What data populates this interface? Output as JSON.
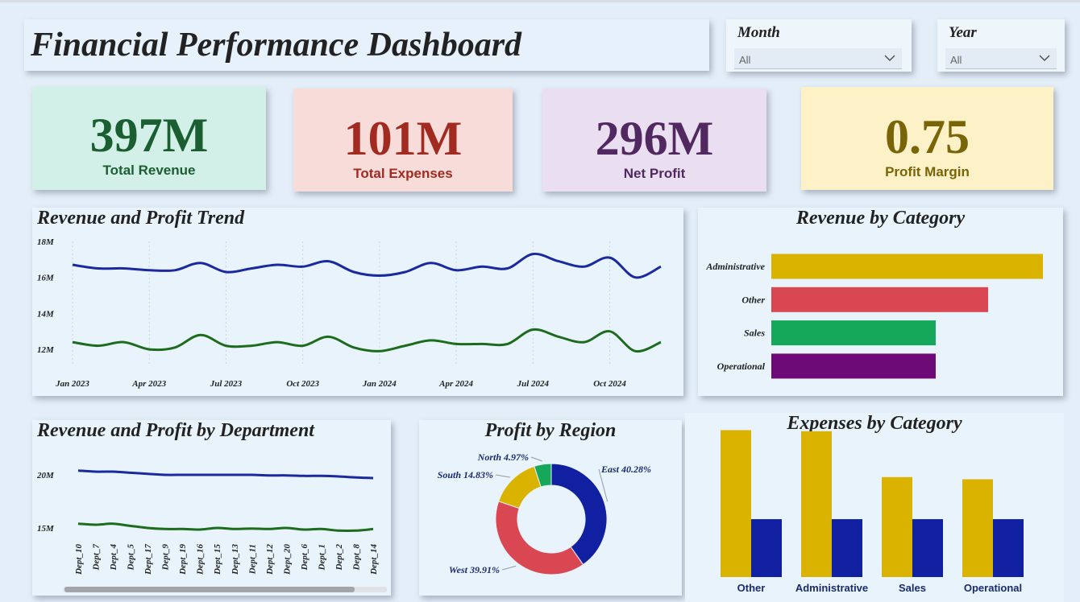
{
  "header": {
    "title": "Financial Performance Dashboard"
  },
  "filters": {
    "month": {
      "label": "Month",
      "value": "All"
    },
    "year": {
      "label": "Year",
      "value": "All"
    }
  },
  "kpis": [
    {
      "value": "397M",
      "label": "Total Revenue",
      "color": "#1a5e32",
      "bg": "#d3f0e8"
    },
    {
      "value": "101M",
      "label": "Total Expenses",
      "color": "#a12b21",
      "bg": "#f8dcd9"
    },
    {
      "value": "296M",
      "label": "Net Profit",
      "color": "#512960",
      "bg": "#eadff0"
    },
    {
      "value": "0.75",
      "label": "Profit Margin",
      "color": "#7a6408",
      "bg": "#fcf1c7"
    }
  ],
  "colors": {
    "blue": "#1a2a9e",
    "green": "#1d6b1d",
    "gold": "#d9b300",
    "red": "#d94852",
    "teal": "#16a85a",
    "purple": "#6e0a78",
    "navy": "#1020a0"
  },
  "chart_data": [
    {
      "id": "trend",
      "type": "line",
      "title": "Revenue and Profit Trend",
      "x": [
        "2023-01",
        "2023-02",
        "2023-03",
        "2023-04",
        "2023-05",
        "2023-06",
        "2023-07",
        "2023-08",
        "2023-09",
        "2023-10",
        "2023-11",
        "2023-12",
        "2024-01",
        "2024-02",
        "2024-03",
        "2024-04",
        "2024-05",
        "2024-06",
        "2024-07",
        "2024-08",
        "2024-09",
        "2024-10",
        "2024-11",
        "2024-12"
      ],
      "x_tick_labels": [
        "Jan 2023",
        "Apr 2023",
        "Jul 2023",
        "Oct 2023",
        "Jan 2024",
        "Apr 2024",
        "Jul 2024",
        "Oct 2024"
      ],
      "y_tick_labels": [
        "18M",
        "16M",
        "14M",
        "12M"
      ],
      "y_ticks": [
        18,
        16,
        14,
        12
      ],
      "ylim": [
        11.6,
        18
      ],
      "grid": "vertical dotted",
      "series": [
        {
          "values": [
            16.7,
            16.5,
            16.5,
            16.4,
            16.4,
            16.8,
            16.3,
            16.5,
            16.7,
            16.6,
            16.9,
            16.3,
            16.1,
            16.3,
            16.8,
            16.4,
            16.6,
            16.5,
            17.3,
            16.9,
            16.6,
            17.1,
            16.0,
            16.6
          ]
        },
        {
          "values": [
            12.4,
            12.2,
            12.4,
            12.0,
            12.1,
            12.8,
            12.2,
            12.2,
            12.4,
            12.2,
            12.7,
            12.1,
            11.9,
            12.2,
            12.5,
            12.3,
            12.3,
            12.3,
            13.1,
            12.7,
            12.4,
            13.0,
            11.9,
            12.4
          ]
        }
      ]
    },
    {
      "id": "rev_cat",
      "type": "bar",
      "orientation": "horizontal",
      "title": "Revenue by Category",
      "categories": [
        "Administrative",
        "Other",
        "Sales",
        "Operational"
      ],
      "values": [
        114,
        91,
        69,
        69
      ],
      "xlim": [
        0,
        114
      ],
      "bar_colors": [
        "#d9b300",
        "#d94852",
        "#16a85a",
        "#6e0a78"
      ]
    },
    {
      "id": "dept",
      "type": "line",
      "title": "Revenue and Profit by Department",
      "categories": [
        "Dept_10",
        "Dept_7",
        "Dept_4",
        "Dept_5",
        "Dept_17",
        "Dept_9",
        "Dept_19",
        "Dept_16",
        "Dept_15",
        "Dept_13",
        "Dept_11",
        "Dept_12",
        "Dept_20",
        "Dept_6",
        "Dept_1",
        "Dept_2",
        "Dept_8",
        "Dept_14"
      ],
      "y_tick_labels": [
        "20M",
        "15M"
      ],
      "y_ticks": [
        20,
        15
      ],
      "ylim": [
        13.5,
        21.5
      ],
      "series": [
        {
          "values": [
            20.4,
            20.3,
            20.3,
            20.2,
            20.1,
            20.0,
            20.0,
            20.0,
            20.0,
            20.0,
            20.0,
            19.95,
            19.95,
            19.9,
            19.9,
            19.85,
            19.75,
            19.7
          ]
        },
        {
          "values": [
            15.4,
            15.3,
            15.4,
            15.2,
            15.0,
            14.9,
            14.9,
            14.85,
            15.0,
            14.9,
            14.95,
            14.9,
            15.0,
            14.85,
            14.9,
            14.75,
            14.75,
            14.9
          ]
        }
      ]
    },
    {
      "id": "region",
      "type": "pie",
      "title": "Profit by Region",
      "categories": [
        "East",
        "West",
        "South",
        "North"
      ],
      "values": [
        40.28,
        39.91,
        14.83,
        4.97
      ],
      "labels": [
        "East 40.28%",
        "West 39.91%",
        "South 14.83%",
        "North 4.97%"
      ],
      "slice_colors": [
        "#1020a0",
        "#d94852",
        "#d9b300",
        "#16a85a"
      ]
    },
    {
      "id": "exp_cat",
      "type": "bar",
      "title": "Expenses by Category",
      "categories": [
        "Other",
        "Administrative",
        "Sales",
        "Operational"
      ],
      "series": [
        {
          "values": [
            26.9,
            26.7,
            18.3,
            17.9
          ],
          "color": "#d9b300"
        },
        {
          "values": [
            10.6,
            10.6,
            10.6,
            10.6
          ],
          "color": "#1020a0"
        }
      ],
      "ylim": [
        0,
        28
      ]
    }
  ]
}
